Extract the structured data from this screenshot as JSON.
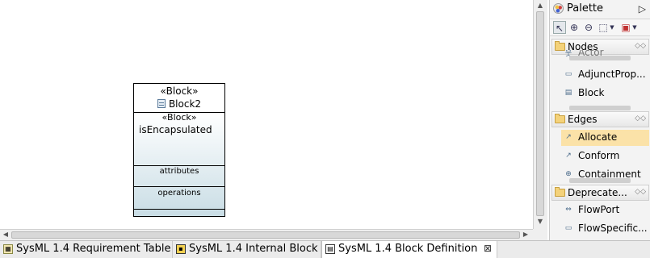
{
  "diagram": {
    "block": {
      "stereotype": "«Block»",
      "name": "Block2",
      "property_stereotype": "«Block»",
      "property": "isEncapsulated",
      "attributes_label": "attributes",
      "operations_label": "operations"
    }
  },
  "palette": {
    "title": "Palette",
    "drawers": [
      {
        "label": "Nodes",
        "items": [
          {
            "label": "Actor",
            "icon": "actor-icon"
          },
          {
            "label": "AdjunctProp...",
            "icon": "adjunct-property-icon"
          },
          {
            "label": "Block",
            "icon": "block-icon"
          }
        ]
      },
      {
        "label": "Edges",
        "items": [
          {
            "label": "Allocate",
            "icon": "allocate-icon"
          },
          {
            "label": "Conform",
            "icon": "conform-icon"
          },
          {
            "label": "Containment",
            "icon": "containment-icon"
          }
        ]
      },
      {
        "label": "Deprecate...",
        "items": [
          {
            "label": "FlowPort",
            "icon": "flowport-icon"
          },
          {
            "label": "FlowSpecific...",
            "icon": "flowspecification-icon"
          }
        ]
      }
    ]
  },
  "tabs": [
    {
      "label": "SysML 1.4 Requirement Table",
      "active": false
    },
    {
      "label": "SysML 1.4 Internal Block",
      "active": false
    },
    {
      "label": "SysML 1.4 Block Definition",
      "active": true
    }
  ],
  "close_glyph": "⊠"
}
